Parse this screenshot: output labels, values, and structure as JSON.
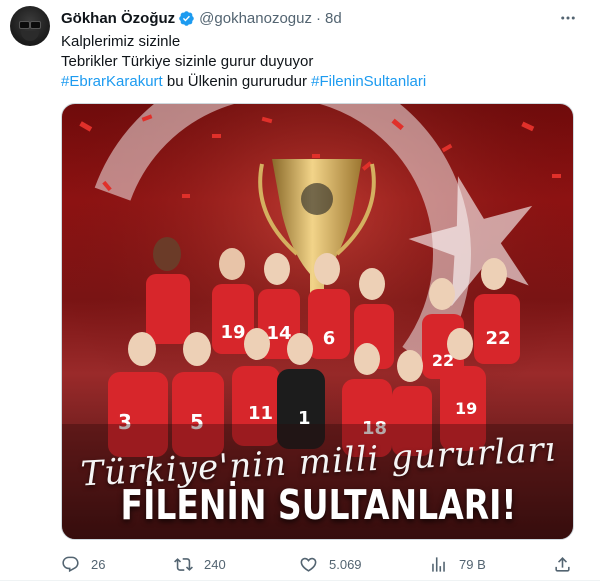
{
  "tweet": {
    "author_name": "Gökhan Özoğuz",
    "author_handle": "@gokhanozoguz",
    "separator": "·",
    "time": "8d",
    "lines": [
      "Kalplerimiz sizinle",
      "Tebrikler Türkiye sizinle gurur duyuyor"
    ],
    "line3": {
      "hashtag1": "#EbrarKarakurt",
      "middle": " bu Ülkenin gururudur ",
      "hashtag2": "#FileninSultanlari"
    },
    "media": {
      "script_text": "Türkiye'nin milli gururları",
      "title_text": "FİLENİN SULTANLARI!"
    },
    "actions": {
      "replies": "26",
      "retweets": "240",
      "likes": "5.069",
      "views": "79 B"
    }
  },
  "colors": {
    "accent": "#1d9bf0",
    "secondary_text": "#536471",
    "primary_text": "#0f1419",
    "jersey_red": "#d7262b"
  },
  "icons": {
    "verified": "verified-badge-icon",
    "more": "more-icon",
    "reply": "reply-icon",
    "retweet": "retweet-icon",
    "like": "heart-icon",
    "views": "views-icon",
    "share": "share-icon"
  }
}
